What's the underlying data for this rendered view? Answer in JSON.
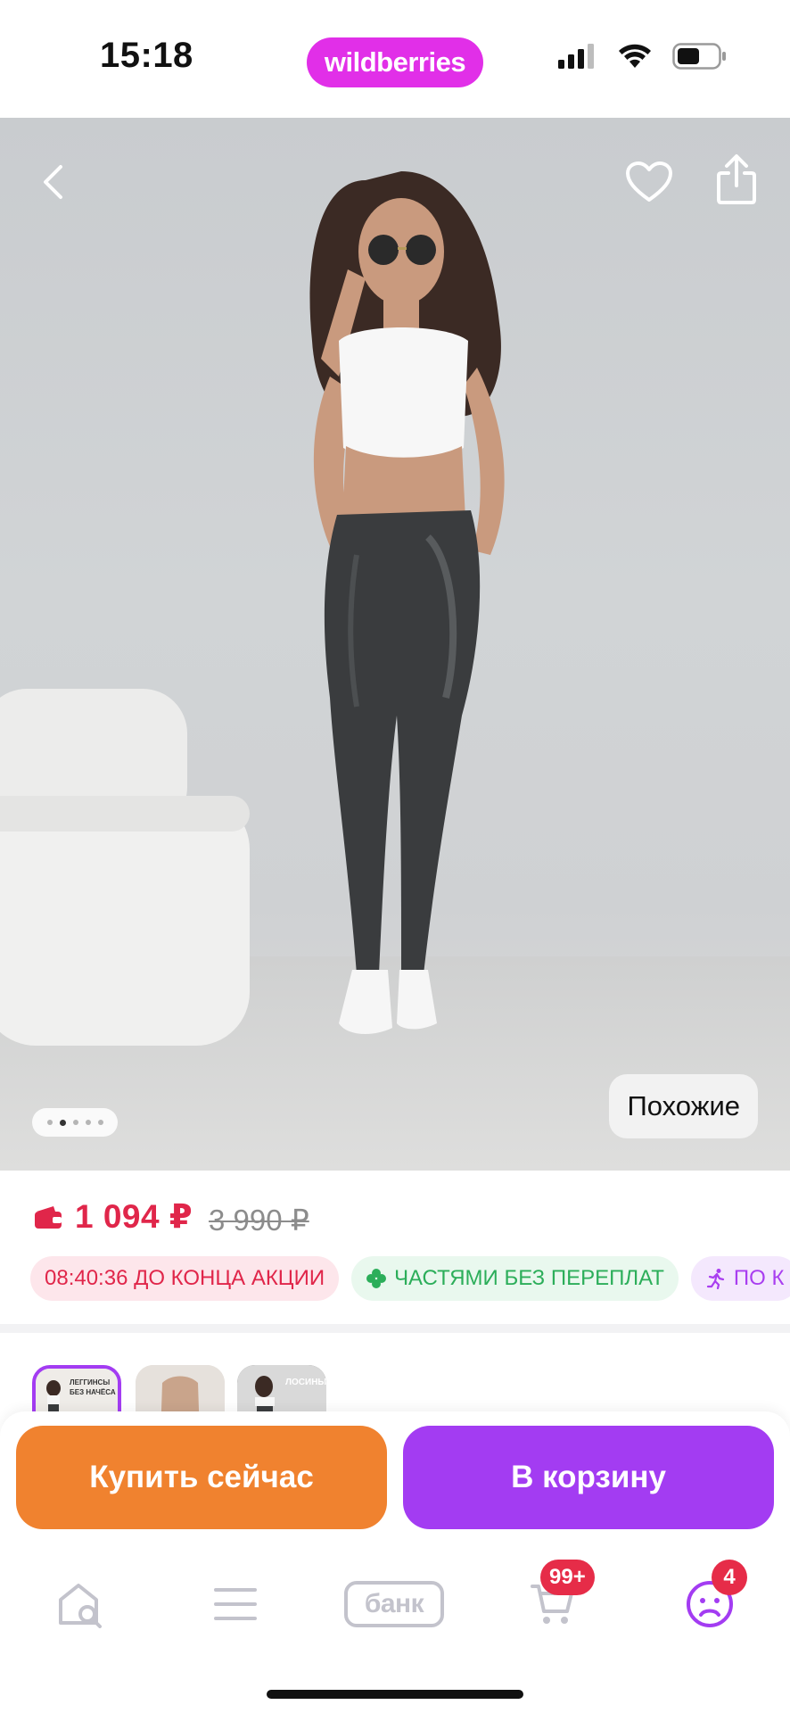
{
  "status_bar": {
    "time": "15:18",
    "brand": "wildberries",
    "icons": [
      "cellular-signal-icon",
      "wifi-icon",
      "battery-icon"
    ]
  },
  "hero": {
    "icons": [
      "back-icon",
      "heart-icon",
      "share-icon"
    ],
    "similar_label": "Похожие",
    "image_count": 5,
    "active_image_index": 1
  },
  "price": {
    "current": "1 094 ₽",
    "old": "3 990 ₽",
    "icon": "wallet-icon",
    "color_current": "#e0264a"
  },
  "chips": [
    {
      "id": "timer",
      "text": "08:40:36 ДО КОНЦА АКЦИИ"
    },
    {
      "id": "parts",
      "text": "ЧАСТЯМИ БЕЗ ПЕРЕПЛАТ",
      "icon": "clover-icon"
    },
    {
      "id": "delivery",
      "text": "ПО К",
      "icon": "running-person-icon"
    }
  ],
  "thumbnails": {
    "items": [
      {
        "caption": "ЛЕГГИНСЫ БЕЗ НАЧЁСА"
      },
      {
        "caption": ""
      },
      {
        "caption": "ЛОСИНЫ"
      }
    ],
    "selected_index": 0
  },
  "actions": {
    "buy_now": "Купить сейчас",
    "add_to_cart": "В корзину",
    "buy_color": "#f0822f",
    "cart_color": "#a33cf2"
  },
  "tab_bar": {
    "items": [
      {
        "name": "home",
        "icon": "home-search-icon"
      },
      {
        "name": "catalog",
        "icon": "menu-icon"
      },
      {
        "name": "bank",
        "label": "банк"
      },
      {
        "name": "cart",
        "icon": "cart-icon",
        "badge": "99+"
      },
      {
        "name": "profile",
        "icon": "profile-icon",
        "badge": "4"
      }
    ]
  }
}
